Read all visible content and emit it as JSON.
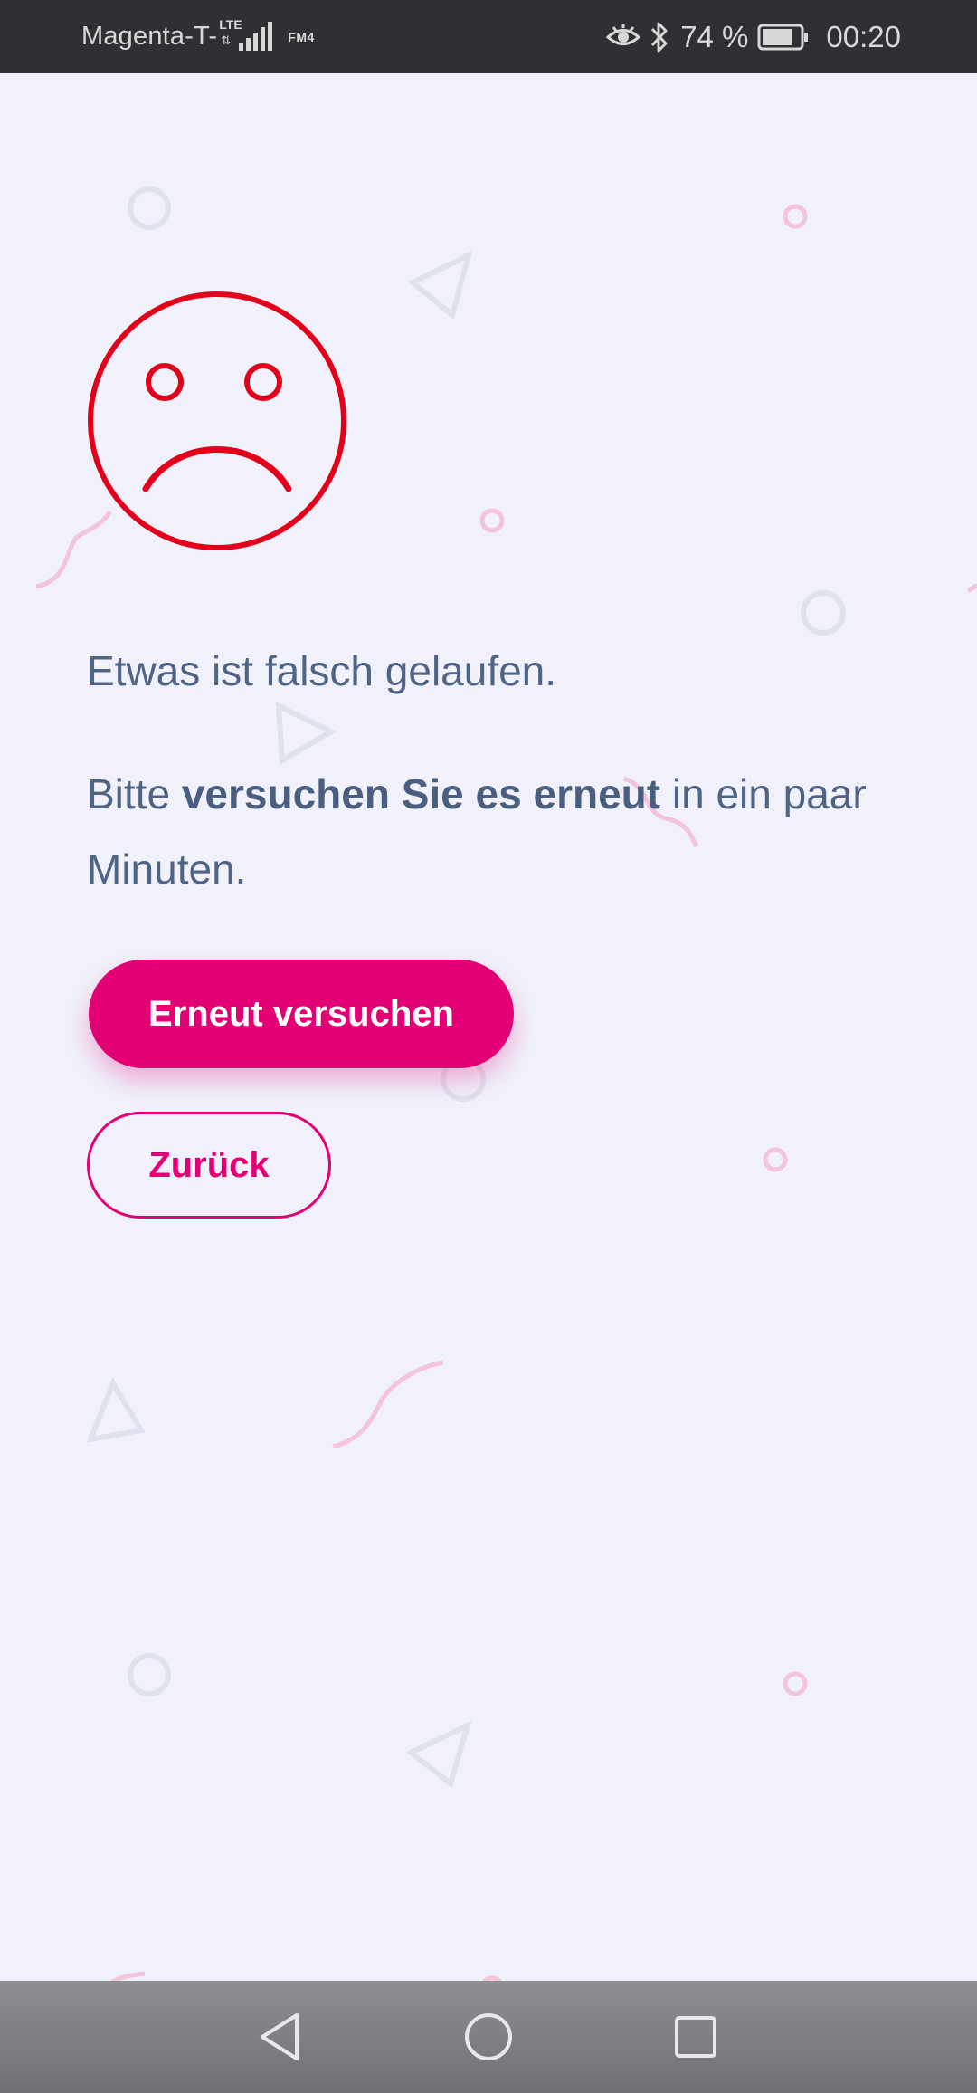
{
  "status_bar": {
    "carrier": "Magenta-T-",
    "network_type": "LTE",
    "radio_label": "FM4",
    "battery_percent": "74 %",
    "time": "00:20",
    "icons": [
      "signal-icon",
      "eye-icon",
      "bluetooth-icon",
      "battery-icon"
    ]
  },
  "error": {
    "icon": "sad-face-icon",
    "title": "Etwas ist falsch gelaufen.",
    "message_prefix": "Bitte ",
    "message_emphasis": "versuchen Sie es erneut",
    "message_suffix": " in ein paar Minuten."
  },
  "actions": {
    "retry_label": "Erneut versuchen",
    "back_label": "Zurück"
  },
  "nav_bar": {
    "icons": [
      "back-triangle-icon",
      "home-circle-icon",
      "recents-square-icon"
    ]
  },
  "colors": {
    "accent": "#e20074",
    "error_icon": "#e2001a",
    "text": "#4f6384",
    "background": "#f0f1fa",
    "status_bar": "#2f3033"
  }
}
